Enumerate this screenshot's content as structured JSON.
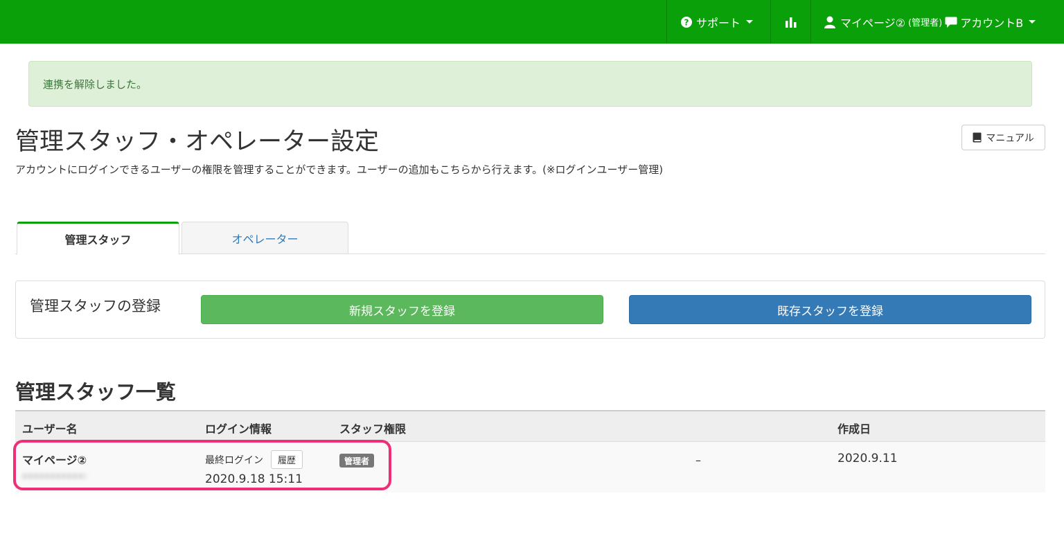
{
  "navbar": {
    "support_label": "サポート",
    "account_user": "マイページ②",
    "account_role": "(管理者)",
    "account_name": "アカウントB",
    "bg_color": "#09a00a"
  },
  "alert": {
    "message": "連携を解除しました。"
  },
  "header": {
    "title": "管理スタッフ・オペレーター設定",
    "manual_label": "マニュアル",
    "description": "アカウントにログインできるユーザーの権限を管理することができます。ユーザーの追加もこちらから行えます。(※ログインユーザー管理)"
  },
  "tabs": [
    {
      "label": "管理スタッフ",
      "active": true
    },
    {
      "label": "オペレーター",
      "active": false
    }
  ],
  "register": {
    "title": "管理スタッフの登録",
    "new_label": "新規スタッフを登録",
    "existing_label": "既存スタッフを登録"
  },
  "list": {
    "title": "管理スタッフ一覧",
    "headers": {
      "user": "ユーザー名",
      "login": "ログイン情報",
      "role": "スタッフ権限",
      "created": "作成日"
    },
    "rows": [
      {
        "name": "マイページ②",
        "login_label": "最終ログイン",
        "history_label": "履歴",
        "last_login": "2020.9.18 15:11",
        "role": "管理者",
        "extra": "–",
        "created": "2020.9.11"
      }
    ]
  }
}
